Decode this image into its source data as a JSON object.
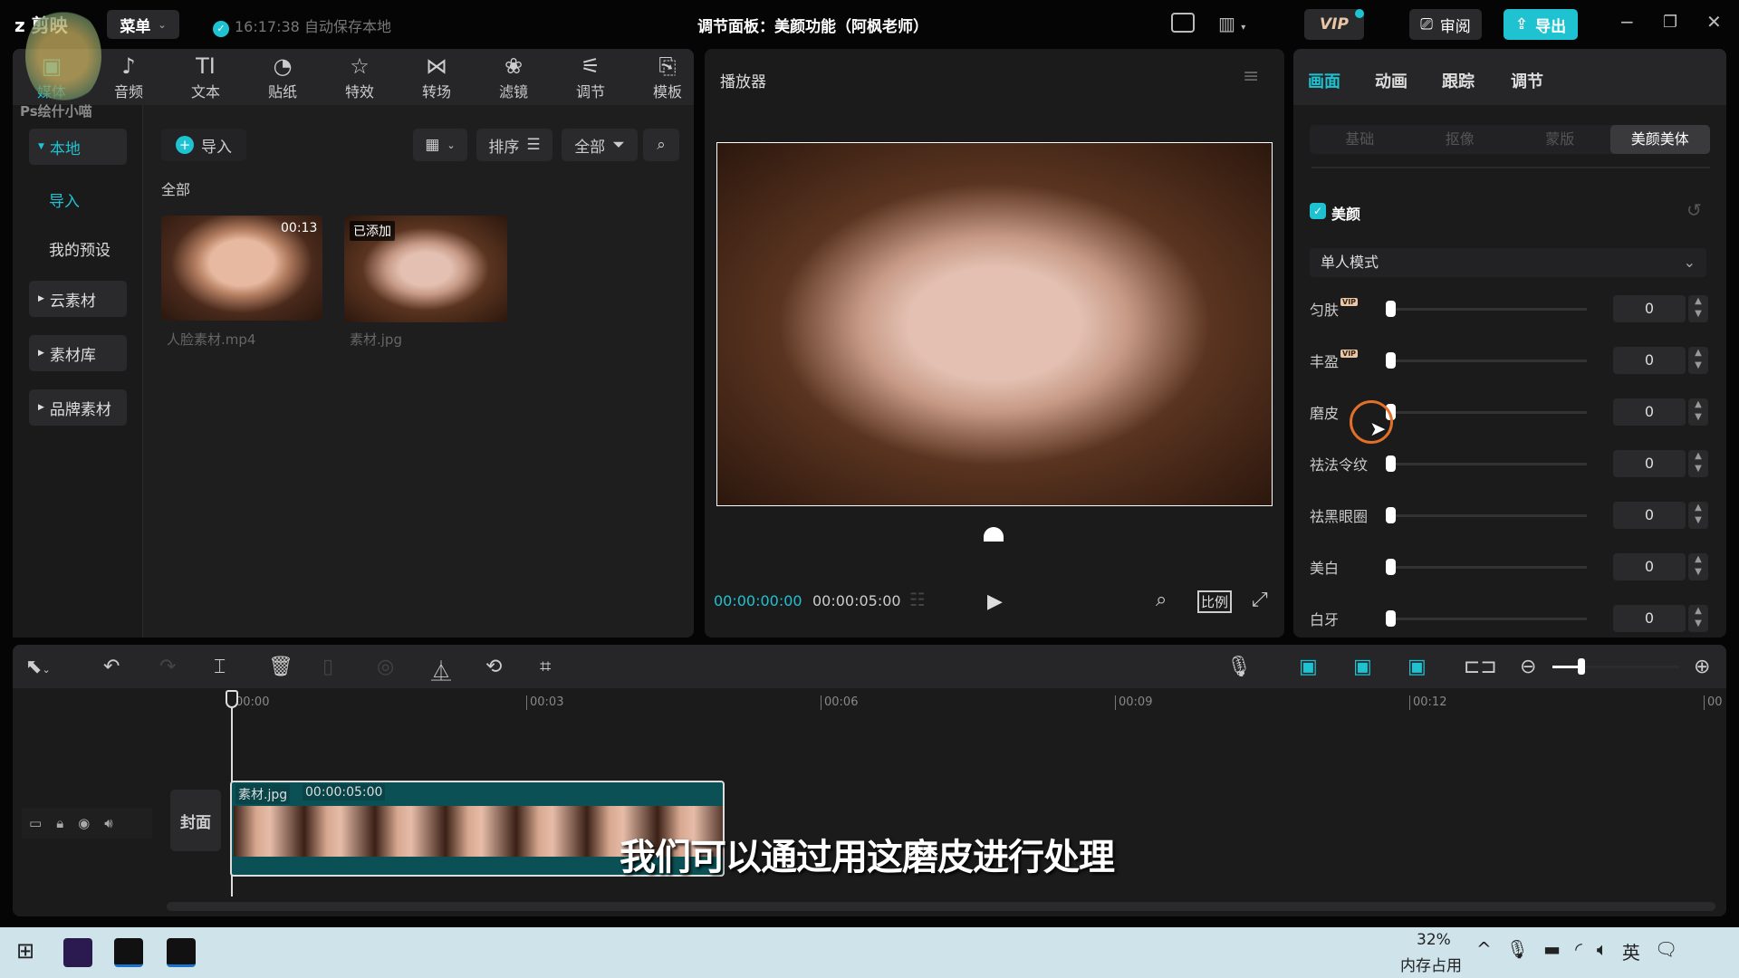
{
  "titlebar": {
    "app_name": "剪映",
    "menu_label": "菜单",
    "autosave": "16:17:38 自动保存本地",
    "title": "调节面板：美颜功能（阿枫老师）",
    "vip": "VIP",
    "review": "审阅",
    "export": "导出"
  },
  "watermark": "Ps绘什小喵",
  "toolbar": [
    {
      "icon": "media-icon",
      "label": "媒体",
      "glyph": "▣"
    },
    {
      "icon": "audio-icon",
      "label": "音频",
      "glyph": "♪"
    },
    {
      "icon": "text-icon",
      "label": "文本",
      "glyph": "TI"
    },
    {
      "icon": "sticker-icon",
      "label": "贴纸",
      "glyph": "◔"
    },
    {
      "icon": "effects-icon",
      "label": "特效",
      "glyph": "☆"
    },
    {
      "icon": "transition-icon",
      "label": "转场",
      "glyph": "⋈"
    },
    {
      "icon": "filter-icon",
      "label": "滤镜",
      "glyph": "❀"
    },
    {
      "icon": "adjust-icon",
      "label": "调节",
      "glyph": "⚟"
    },
    {
      "icon": "template-icon",
      "label": "模板",
      "glyph": "⎘"
    }
  ],
  "sidebar": {
    "items": [
      {
        "label": "本地",
        "active": true
      },
      {
        "label": "导入"
      },
      {
        "label": "我的预设"
      },
      {
        "label": "云素材"
      },
      {
        "label": "素材库"
      },
      {
        "label": "品牌素材"
      }
    ]
  },
  "media": {
    "import_label": "导入",
    "sort_label": "排序",
    "filter_label": "全部",
    "section": "全部",
    "items": [
      {
        "name": "人脸素材.mp4",
        "badge": "00:13"
      },
      {
        "name": "素材.jpg",
        "badge": "已添加"
      }
    ]
  },
  "player": {
    "title": "播放器",
    "current_time": "00:00:00:00",
    "total_time": "00:00:05:00",
    "ratio_label": "比例"
  },
  "inspector": {
    "tabs": [
      "画面",
      "动画",
      "跟踪",
      "调节"
    ],
    "active_tab": "画面",
    "subtabs": [
      "基础",
      "抠像",
      "蒙版",
      "美颜美体"
    ],
    "active_subtab": "美颜美体",
    "section": "美颜",
    "section_checked": true,
    "mode": "单人模式",
    "sliders": [
      {
        "label": "匀肤",
        "vip": true,
        "value": "0"
      },
      {
        "label": "丰盈",
        "vip": true,
        "value": "0"
      },
      {
        "label": "磨皮",
        "vip": false,
        "value": "0"
      },
      {
        "label": "祛法令纹",
        "vip": false,
        "value": "0"
      },
      {
        "label": "祛黑眼圈",
        "vip": false,
        "value": "0"
      },
      {
        "label": "美白",
        "vip": false,
        "value": "0"
      },
      {
        "label": "白牙",
        "vip": false,
        "value": "0"
      }
    ]
  },
  "timeline": {
    "ticks": [
      "00:00",
      "00:03",
      "00:06",
      "00:09",
      "00:12",
      "00"
    ],
    "cover_label": "封面",
    "clip_name": "素材.jpg",
    "clip_duration": "00:00:05:00"
  },
  "subtitle": "我们可以通过用这磨皮进行处理",
  "taskbar": {
    "memory_percent": "32%",
    "memory_label": "内存占用",
    "ime": "英"
  },
  "colors": {
    "accent": "#1fc2d0",
    "clip": "#0b5055",
    "taskbar": "#cfe3ea"
  }
}
